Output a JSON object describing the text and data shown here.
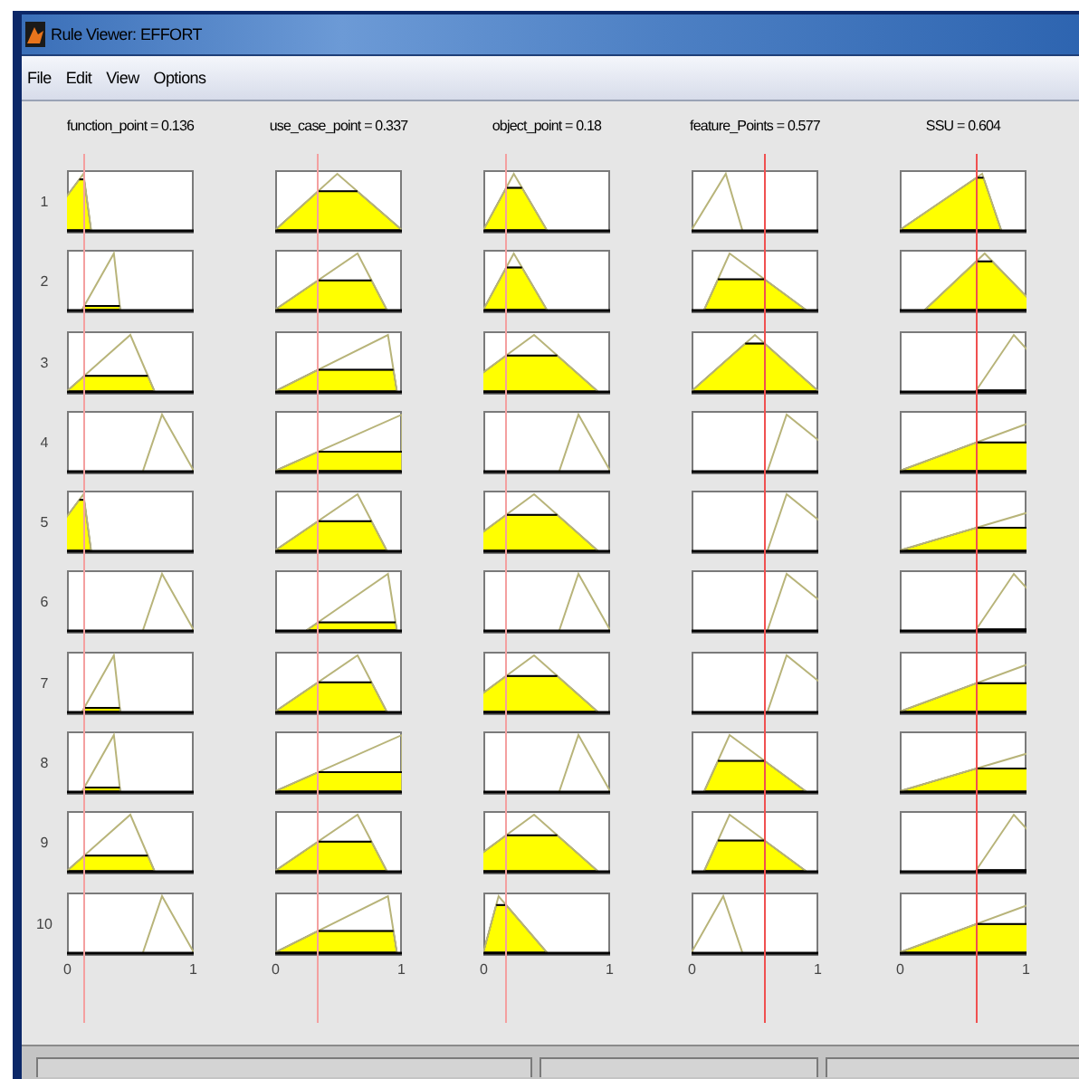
{
  "window": {
    "title": "Rule Viewer: EFFORT"
  },
  "menu": [
    "File",
    "Edit",
    "View",
    "Options"
  ],
  "inputs": [
    {
      "label": "function_point = 0.136",
      "axis_min": "0",
      "axis_max": "1"
    },
    {
      "label": "use_case_point = 0.337",
      "axis_min": "0",
      "axis_max": "1"
    },
    {
      "label": "object_point = 0.18",
      "axis_min": "0",
      "axis_max": "1"
    },
    {
      "label": "feature_Points = 0.577",
      "axis_min": "0",
      "axis_max": "1"
    },
    {
      "label": "SSU = 0.604",
      "axis_min": "0",
      "axis_max": "1"
    }
  ],
  "rules": [
    "1",
    "2",
    "3",
    "4",
    "5",
    "6",
    "7",
    "8",
    "9",
    "10"
  ]
}
